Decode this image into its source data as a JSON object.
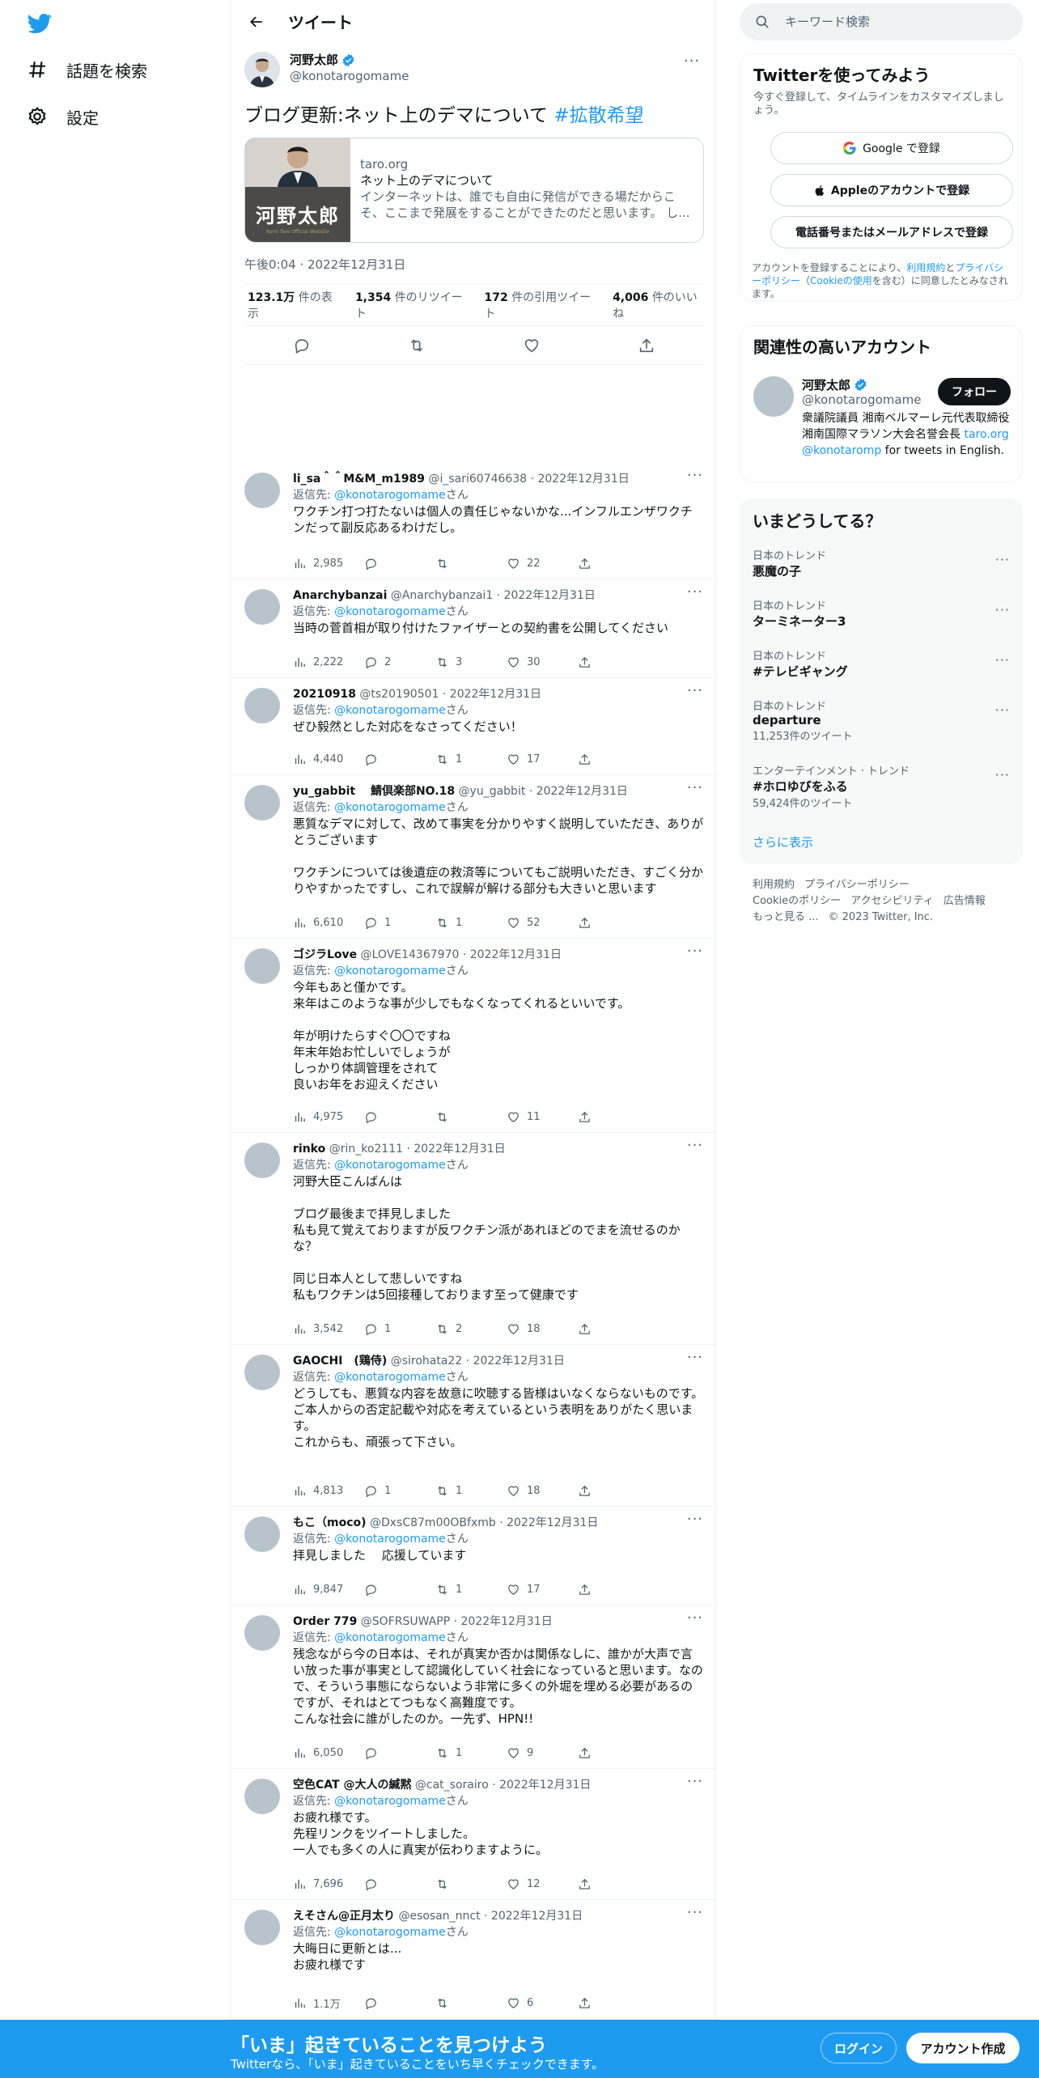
{
  "nav": {
    "explore_label": "話題を検索",
    "settings_label": "設定"
  },
  "header": {
    "title": "ツイート"
  },
  "main_tweet": {
    "author_name": "河野太郎",
    "author_handle": "@konotarogomame",
    "text": "ブログ更新:ネット上のデマについて",
    "hashtag": "#拡散希望",
    "card": {
      "domain": "taro.org",
      "title": "ネット上のデマについて",
      "description": "インターネットは、誰でも自由に発信ができる場だからこそ、ここまで発展をすることができたのだと思います。 し...",
      "image_caption": "河野太郎",
      "image_small_text": "Kono Taro Official Website"
    },
    "timestamp": "午後0:04 · 2022年12月31日",
    "stats": {
      "views": "123.1万",
      "views_label": "件の表示",
      "retweets": "1,354",
      "retweets_label": "件のリツイート",
      "quotes": "172",
      "quotes_label": "件の引用ツイート",
      "likes": "4,006",
      "likes_label": "件のいいね"
    }
  },
  "replying_prefix": "返信先: ",
  "replying_handle": "@konotarogomame",
  "replying_suffix": "さん",
  "replies": [
    {
      "name": "li_sa＾＾M&M_m1989",
      "handle": "@i_sari60746638 · 2022年12月31日",
      "body": "ワクチン打つ打たないは個人の責任じゃないかな...インフルエンザワクチンだって副反応あるわけだし。",
      "views": "2,985",
      "replies": "",
      "retweets": "",
      "likes": "22"
    },
    {
      "name": "Anarchybanzai",
      "handle": "@Anarchybanzai1 · 2022年12月31日",
      "body": "当時の菅首相が取り付けたファイザーとの契約書を公開してください",
      "views": "2,222",
      "replies": "2",
      "retweets": "3",
      "likes": "30"
    },
    {
      "name": "20210918",
      "handle": "@ts20190501 · 2022年12月31日",
      "body": "ぜひ毅然とした対応をなさってください！",
      "views": "4,440",
      "replies": "",
      "retweets": "1",
      "likes": "17"
    },
    {
      "name": "yu_gabbit　 鯖倶楽部NO.18",
      "handle": "@yu_gabbit · 2022年12月31日",
      "body": "悪質なデマに対して、改めて事実を分かりやすく説明していただき、ありがとうございます\n\nワクチンについては後遺症の救済等についてもご説明いただき、すごく分かりやすかったですし、これで誤解が解ける部分も大きいと思います",
      "views": "6,610",
      "replies": "1",
      "retweets": "1",
      "likes": "52"
    },
    {
      "name": "ゴジラLove",
      "handle": "@LOVE14367970 · 2022年12月31日",
      "body": "今年もあと僅かです。\n来年はこのような事が少しでもなくなってくれるといいです。\n\n年が明けたらすぐ〇〇ですね\n年末年始お忙しいでしょうが\nしっかり体調管理をされて\n良いお年をお迎えください",
      "views": "4,975",
      "replies": "",
      "retweets": "",
      "likes": "11"
    },
    {
      "name": "rinko",
      "handle": "@rin_ko2111 · 2022年12月31日",
      "body": "河野大臣こんばんは\n\nブログ最後まで拝見しました\n私も見て覚えておりますが反ワクチン派があれほどのでまを流せるのかな？\n\n同じ日本人として悲しいですね\n私もワクチンは5回接種しております至って健康です",
      "views": "3,542",
      "replies": "1",
      "retweets": "2",
      "likes": "18"
    },
    {
      "name": "GAOCHI　(鶏侍)",
      "handle": "@sirohata22 · 2022年12月31日",
      "body": "どうしても、悪質な内容を故意に吹聴する皆様はいなくならないものです。\nご本人からの否定記載や対応を考えているという表明をありがたく思います。\nこれからも、頑張って下さい。",
      "views": "4,813",
      "replies": "1",
      "retweets": "1",
      "likes": "18"
    },
    {
      "name": "もこ（moco)",
      "handle": "@DxsC87m00OBfxmb · 2022年12月31日",
      "body": "拝見しました　 応援しています",
      "views": "9,847",
      "replies": "",
      "retweets": "1",
      "likes": "17"
    },
    {
      "name": "Order 779",
      "handle": "@SOFRSUWAPP · 2022年12月31日",
      "body": "残念ながら今の日本は、それが真実か否かは関係なしに、誰かが大声で言い放った事が事実として認識化していく社会になっていると思います。なので、そういう事態にならないよう非常に多くの外堀を埋める必要があるのですが、それはとてつもなく高難度です。\nこんな社会に誰がしたのか。一先ず、HPN!!",
      "views": "6,050",
      "replies": "",
      "retweets": "1",
      "likes": "9"
    },
    {
      "name": "空色CAT @大人の緘黙",
      "handle": "@cat_sorairo · 2022年12月31日",
      "body": "お疲れ様です。\n先程リンクをツイートしました。\n一人でも多くの人に真実が伝わりますように。",
      "views": "7,696",
      "replies": "",
      "retweets": "",
      "likes": "12"
    },
    {
      "name": "えそさん@正月太り",
      "handle": "@esosan_nnct · 2022年12月31日",
      "body": "大晦日に更新とは...\nお疲れ様です",
      "views": "1.1万",
      "replies": "",
      "retweets": "",
      "likes": "6"
    }
  ],
  "sidebar": {
    "search_placeholder": "キーワード検索",
    "signup_panel": {
      "title": "Twitterを使ってみよう",
      "subtitle": "今すぐ登録して、タイムラインをカスタマイズしましょう。",
      "google_btn": "Google で登録",
      "apple_btn": "Appleのアカウントで登録",
      "phone_btn": "電話番号またはメールアドレスで登録",
      "terms_pre": "アカウントを登録することにより、",
      "terms_link": "利用規約",
      "terms_and": "と",
      "privacy_link": "プライバシーポリシー",
      "cookie_pre": "（",
      "cookie_link": "Cookieの使用",
      "terms_post": "を含む）に同意したとみなされます。"
    },
    "related": {
      "title": "関連性の高いアカウント",
      "name": "河野太郎",
      "handle": "@konotarogomame",
      "follow_label": "フォロー",
      "bio": "衆議院議員 湘南ベルマーレ元代表取締役 湘南国際マラソン大会名誉会長 ",
      "bio_link1": "taro.org",
      "bio_link2": "@konotaromp",
      "bio_tail": " for tweets in English."
    },
    "trends": {
      "title": "いまどうしてる？",
      "items": [
        {
          "context": "日本のトレンド",
          "name": "悪魔の子",
          "count": ""
        },
        {
          "context": "日本のトレンド",
          "name": "ターミネーター3",
          "count": ""
        },
        {
          "context": "日本のトレンド",
          "name": "#テレビギャング",
          "count": ""
        },
        {
          "context": "日本のトレンド",
          "name": "departure",
          "count": "11,253件のツイート"
        },
        {
          "context": "エンターテインメント · トレンド",
          "name": "#ホロゆびをふる",
          "count": "59,424件のツイート"
        }
      ],
      "show_more": "さらに表示"
    },
    "footer": {
      "terms": "利用規約",
      "privacy": "プライバシーポリシー",
      "cookie": "Cookieのポリシー",
      "accessibility": "アクセシビリティ",
      "ads": "広告情報",
      "more": "もっと見る ...",
      "copyright": "© 2023 Twitter, Inc."
    }
  },
  "bottombar": {
    "title": "「いま」起きていることを見つけよう",
    "subtitle": "Twitterなら、「いま」起きていることをいち早くチェックできます。",
    "login": "ログイン",
    "signup": "アカウント作成"
  },
  "colors": {
    "accent": "#1d9bf0",
    "text": "#0f1419",
    "muted": "#536471",
    "border": "#eff3f4"
  }
}
